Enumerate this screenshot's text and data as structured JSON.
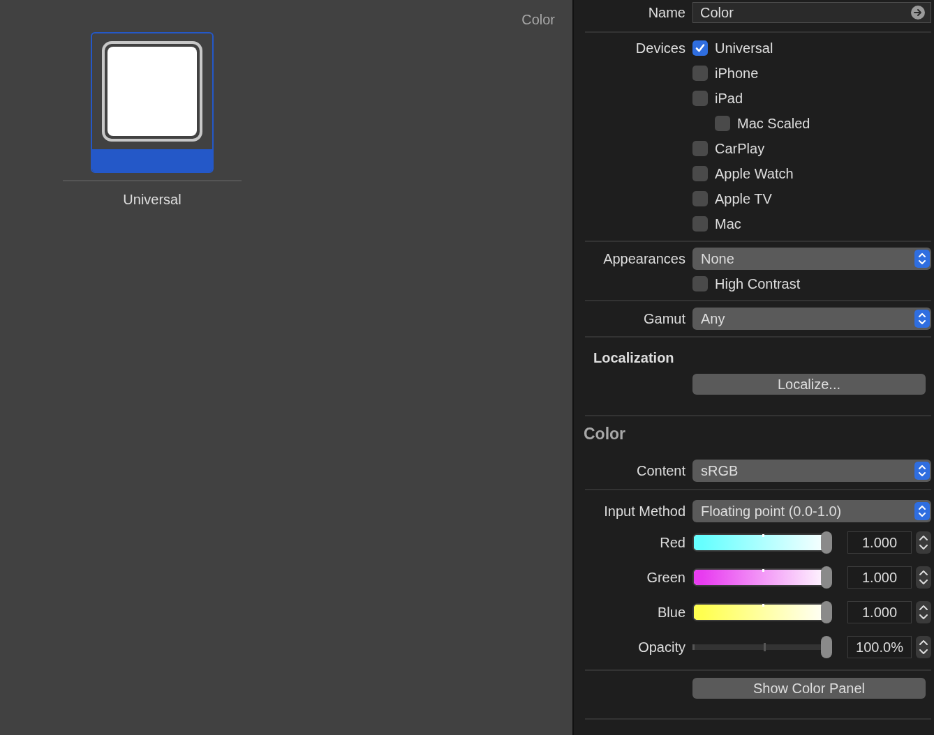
{
  "canvas": {
    "title": "Color",
    "variants": [
      {
        "label": "Universal",
        "selected": true
      }
    ]
  },
  "inspector": {
    "name": {
      "label": "Name",
      "value": "Color"
    },
    "devices": {
      "label": "Devices",
      "items": [
        {
          "label": "Universal",
          "checked": true
        },
        {
          "label": "iPhone",
          "checked": false
        },
        {
          "label": "iPad",
          "checked": false,
          "children": [
            {
              "label": "Mac Scaled",
              "checked": false
            }
          ]
        },
        {
          "label": "CarPlay",
          "checked": false
        },
        {
          "label": "Apple Watch",
          "checked": false
        },
        {
          "label": "Apple TV",
          "checked": false
        },
        {
          "label": "Mac",
          "checked": false
        }
      ]
    },
    "appearances": {
      "label": "Appearances",
      "value": "None",
      "high_contrast": {
        "label": "High Contrast",
        "checked": false
      }
    },
    "gamut": {
      "label": "Gamut",
      "value": "Any"
    },
    "localization": {
      "heading": "Localization",
      "button": "Localize..."
    },
    "color_section": {
      "heading": "Color",
      "content": {
        "label": "Content",
        "value": "sRGB"
      },
      "input_method": {
        "label": "Input Method",
        "value": "Floating point (0.0-1.0)"
      },
      "sliders": [
        {
          "label": "Red",
          "kind": "gradient",
          "color": "#66ffff",
          "level": 1,
          "reading": "1.000"
        },
        {
          "label": "Green",
          "kind": "gradient",
          "color": "#e83cf0",
          "level": 1,
          "reading": "1.000"
        },
        {
          "label": "Blue",
          "kind": "gradient",
          "color": "#ffff50",
          "level": 1,
          "reading": "1.000"
        },
        {
          "label": "Opacity",
          "kind": "plain",
          "level": 1,
          "reading": "100.0%"
        }
      ],
      "button": "Show Color Panel"
    }
  }
}
